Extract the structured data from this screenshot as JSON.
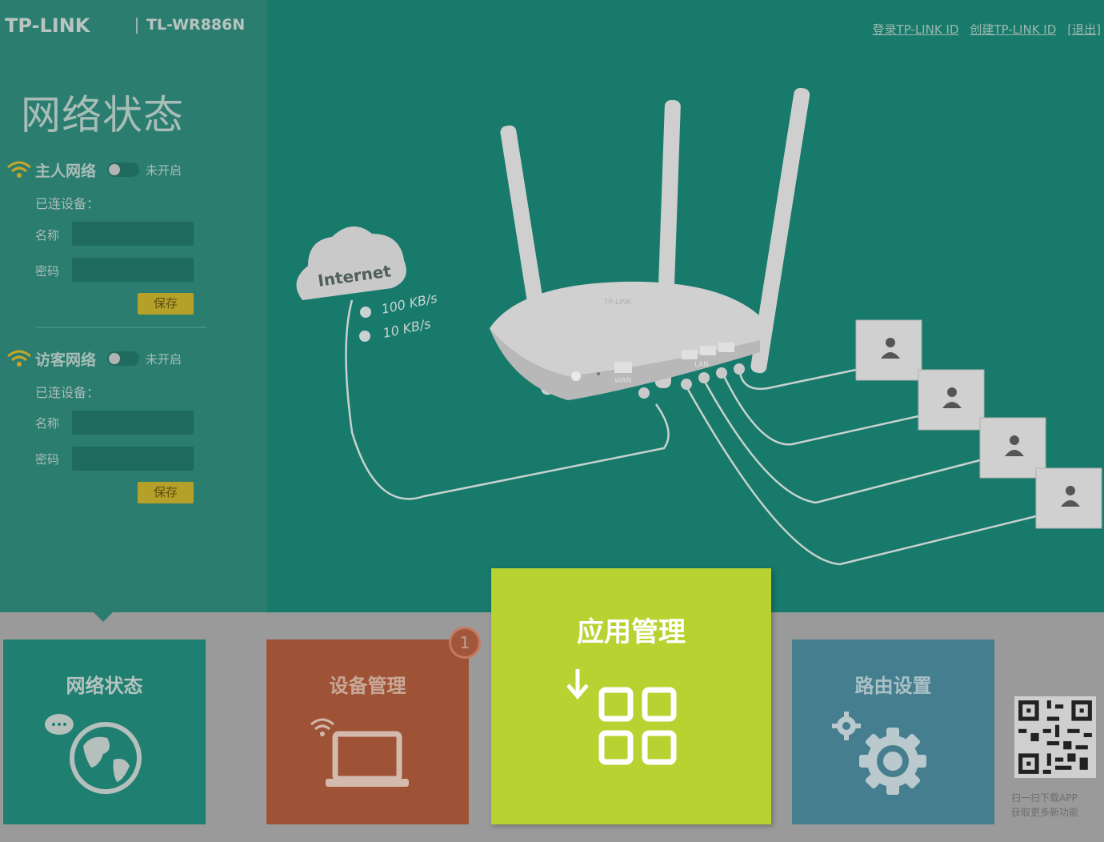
{
  "header": {
    "brand": "TP-LINK",
    "model": "TL-WR886N",
    "links": [
      "登录TP-LINK ID",
      "创建TP-LINK ID",
      "[退出]"
    ]
  },
  "sidebar": {
    "title": "网络状态",
    "main_network": {
      "title": "主人网络",
      "toggle_label": "未开启",
      "connected_label": "已连设备：",
      "name_label": "名称",
      "password_label": "密码",
      "name_value": "",
      "password_value": "",
      "save_label": "保存"
    },
    "guest_network": {
      "title": "访客网络",
      "toggle_label": "未开启",
      "connected_label": "已连设备：",
      "name_label": "名称",
      "password_label": "密码",
      "name_value": "",
      "password_value": "",
      "save_label": "保存"
    }
  },
  "diagram": {
    "internet_label": "Internet",
    "upload_speed": "100 KB/s",
    "download_speed": "10 KB/s",
    "router_brand": "TP-LINK",
    "wan_label": "WAN",
    "lan_label": "LAN",
    "device_count": 4
  },
  "tiles": {
    "network_status": "网络状态",
    "device_management": "设备管理",
    "device_badge": "1",
    "app_management": "应用管理",
    "router_settings": "路由设置"
  },
  "qr": {
    "line1": "扫一扫下载APP",
    "line2": "获取更多新功能"
  },
  "colors": {
    "top_bg": "#177a6b",
    "sidebar_bg": "#2b7d70",
    "save_button": "#b5a12a",
    "tile_network": "#1f7f71",
    "tile_device": "#9e5336",
    "tile_app": "#b8d232",
    "tile_router": "#457e8e"
  }
}
